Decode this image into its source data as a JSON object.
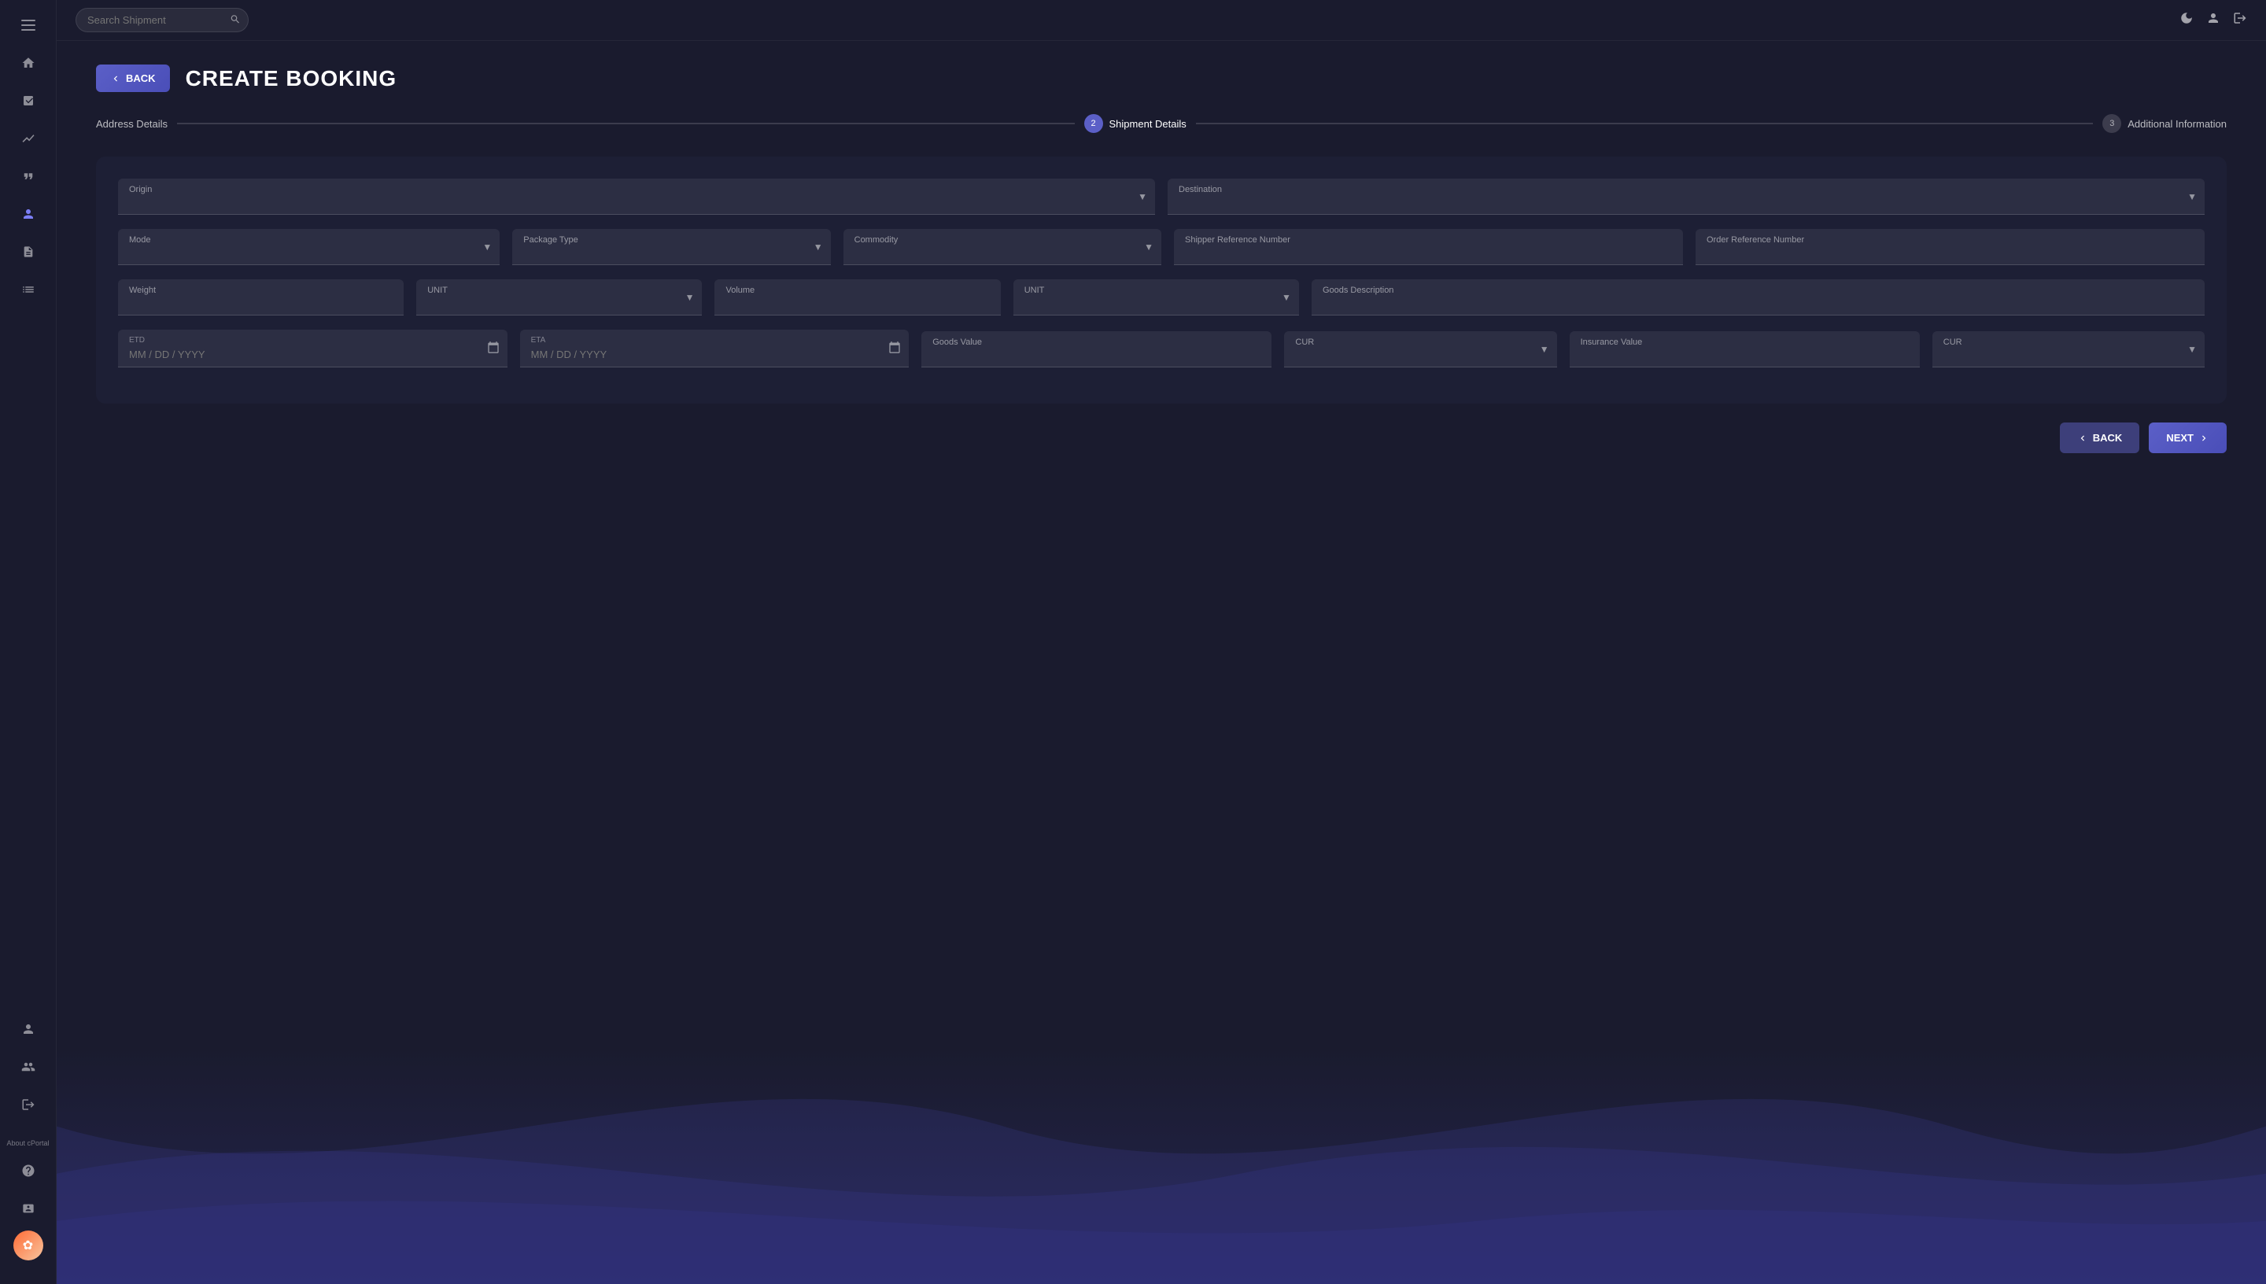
{
  "topbar": {
    "search_placeholder": "Search Shipment"
  },
  "sidebar": {
    "items": [
      {
        "icon": "☰",
        "name": "menu",
        "label": "Menu"
      },
      {
        "icon": "⌂",
        "name": "home",
        "label": "Home"
      },
      {
        "icon": "📋",
        "name": "orders",
        "label": "Orders"
      },
      {
        "icon": "📈",
        "name": "analytics",
        "label": "Analytics"
      },
      {
        "icon": "❝",
        "name": "quotes",
        "label": "Quotes"
      },
      {
        "icon": "👤",
        "name": "contacts",
        "label": "Contacts"
      },
      {
        "icon": "📄",
        "name": "documents",
        "label": "Documents"
      },
      {
        "icon": "≡",
        "name": "reports",
        "label": "Reports"
      }
    ],
    "bottom_items": [
      {
        "icon": "👤",
        "name": "profile-top",
        "label": "Profile"
      },
      {
        "icon": "👥",
        "name": "users",
        "label": "Users"
      },
      {
        "icon": "⤷",
        "name": "logout-top",
        "label": "Logout"
      }
    ],
    "about_label": "About\ncPortal",
    "help_icon": "?",
    "card_icon": "🪪",
    "logo_icon": "✿"
  },
  "page": {
    "title": "CREATE BOOKING",
    "back_button_label": "BACK"
  },
  "stepper": {
    "steps": [
      {
        "number": "",
        "label": "Address Details",
        "active": false
      },
      {
        "number": "2",
        "label": "Shipment Details",
        "active": true
      },
      {
        "number": "3",
        "label": "Additional Information",
        "active": false
      }
    ]
  },
  "form": {
    "origin_placeholder": "Origin",
    "destination_placeholder": "Destination",
    "mode_placeholder": "Mode",
    "package_type_placeholder": "Package Type",
    "commodity_placeholder": "Commodity",
    "shipper_ref_placeholder": "Shipper Reference Number",
    "order_ref_placeholder": "Order Reference Number",
    "weight_placeholder": "Weight",
    "weight_unit_placeholder": "UNIT",
    "volume_placeholder": "Volume",
    "volume_unit_placeholder": "UNIT",
    "goods_desc_placeholder": "Goods Description",
    "etd_label": "ETD",
    "etd_placeholder": "MM / DD / YYYY",
    "eta_label": "ETA",
    "eta_placeholder": "MM / DD / YYYY",
    "goods_value_placeholder": "Goods Value",
    "goods_cur_placeholder": "CUR",
    "insurance_value_placeholder": "Insurance Value",
    "insurance_cur_placeholder": "CUR"
  },
  "navigation": {
    "back_label": "BACK",
    "next_label": "NEXT"
  }
}
